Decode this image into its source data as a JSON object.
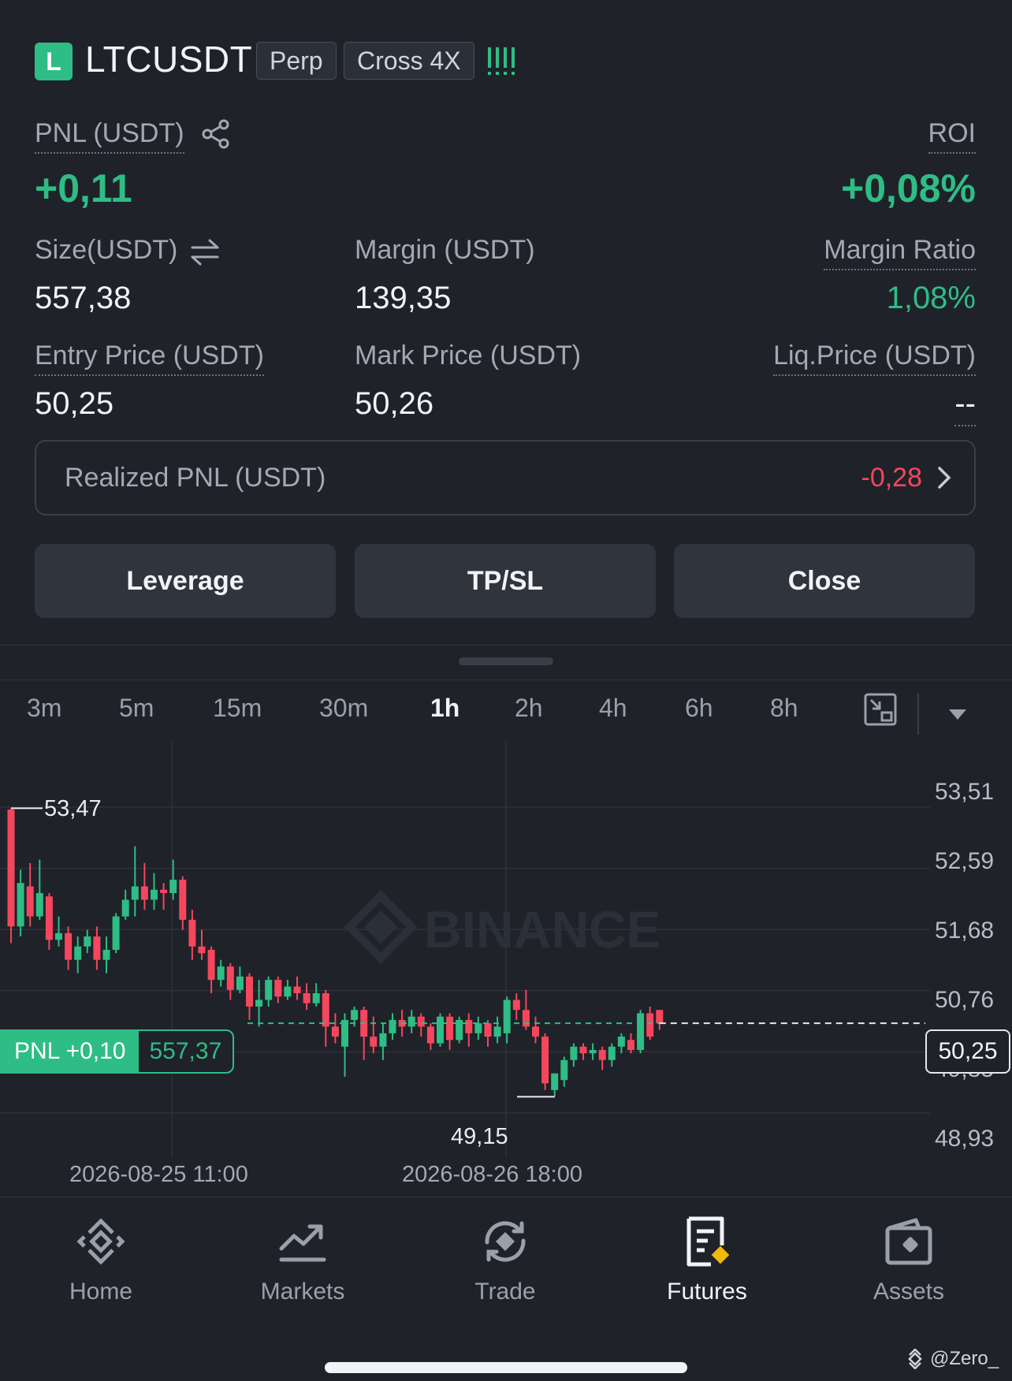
{
  "header": {
    "position_side": "L",
    "symbol": "LTCUSDT",
    "contract_type": "Perp",
    "margin_mode": "Cross 4X"
  },
  "position": {
    "pnl_label": "PNL (USDT)",
    "pnl_value": "+0,11",
    "roi_label": "ROI",
    "roi_value": "+0,08%",
    "size_label": "Size(USDT)",
    "size_value": "557,38",
    "margin_label": "Margin (USDT)",
    "margin_value": "139,35",
    "margin_ratio_label": "Margin Ratio",
    "margin_ratio_value": "1,08%",
    "entry_label": "Entry Price (USDT)",
    "entry_value": "50,25",
    "mark_label": "Mark Price (USDT)",
    "mark_value": "50,26",
    "liq_label": "Liq.Price (USDT)",
    "liq_value": "--",
    "realized_label": "Realized PNL (USDT)",
    "realized_value": "-0,28"
  },
  "actions": {
    "leverage": "Leverage",
    "tpsl": "TP/SL",
    "close": "Close"
  },
  "timeframes": [
    "3m",
    "5m",
    "15m",
    "30m",
    "1h",
    "2h",
    "4h",
    "6h",
    "8h"
  ],
  "active_timeframe": "1h",
  "chart_data": {
    "type": "candlestick",
    "watermark": "BINANCE",
    "y_ticks": [
      "53,51",
      "52,59",
      "51,68",
      "50,76",
      "49,85",
      "48,93"
    ],
    "x_ticks": [
      "2026-08-25 11:00",
      "2026-08-26 18:00"
    ],
    "ylim": [
      48.93,
      53.51
    ],
    "high_label": "53,47",
    "low_label": "49,15",
    "entry_price_label": "50,25",
    "pnl_tag": "PNL +0,10",
    "pnl_tag_size": "557,37",
    "candles": [
      [
        53.45,
        51.7,
        53.47,
        51.45
      ],
      [
        51.7,
        52.35,
        52.55,
        51.55
      ],
      [
        52.3,
        51.85,
        52.65,
        51.7
      ],
      [
        51.85,
        52.2,
        52.7,
        51.8
      ],
      [
        52.15,
        51.5,
        52.2,
        51.35
      ],
      [
        51.5,
        51.6,
        51.85,
        51.4
      ],
      [
        51.6,
        51.2,
        51.7,
        51.05
      ],
      [
        51.2,
        51.4,
        51.55,
        51.0
      ],
      [
        51.4,
        51.55,
        51.65,
        51.3
      ],
      [
        51.55,
        51.2,
        51.7,
        51.05
      ],
      [
        51.2,
        51.35,
        51.55,
        51.0
      ],
      [
        51.35,
        51.85,
        51.9,
        51.3
      ],
      [
        51.85,
        52.1,
        52.25,
        51.8
      ],
      [
        52.1,
        52.3,
        52.9,
        51.85
      ],
      [
        52.3,
        52.1,
        52.65,
        51.95
      ],
      [
        52.1,
        52.25,
        52.5,
        51.95
      ],
      [
        52.25,
        52.2,
        52.35,
        51.95
      ],
      [
        52.2,
        52.4,
        52.7,
        52.1
      ],
      [
        52.4,
        51.8,
        52.45,
        51.65
      ],
      [
        51.8,
        51.4,
        51.95,
        51.2
      ],
      [
        51.4,
        51.3,
        51.65,
        51.2
      ],
      [
        51.35,
        50.9,
        51.4,
        50.7
      ],
      [
        50.9,
        51.1,
        51.2,
        50.8
      ],
      [
        51.1,
        50.75,
        51.15,
        50.6
      ],
      [
        50.75,
        50.95,
        51.1,
        50.7
      ],
      [
        50.95,
        50.5,
        51.0,
        50.3
      ],
      [
        50.5,
        50.6,
        50.9,
        50.2
      ],
      [
        50.6,
        50.9,
        50.95,
        50.5
      ],
      [
        50.9,
        50.65,
        50.95,
        50.55
      ],
      [
        50.65,
        50.8,
        50.9,
        50.6
      ],
      [
        50.8,
        50.7,
        50.95,
        50.6
      ],
      [
        50.7,
        50.55,
        50.85,
        50.45
      ],
      [
        50.55,
        50.7,
        50.85,
        50.5
      ],
      [
        50.7,
        50.2,
        50.75,
        49.9
      ],
      [
        50.2,
        50.05,
        50.4,
        49.95
      ],
      [
        49.9,
        50.3,
        50.4,
        49.45
      ],
      [
        50.3,
        50.45,
        50.5,
        50.2
      ],
      [
        50.45,
        50.05,
        50.5,
        49.7
      ],
      [
        50.05,
        49.9,
        50.35,
        49.8
      ],
      [
        49.9,
        50.1,
        50.25,
        49.7
      ],
      [
        50.1,
        50.3,
        50.4,
        50.0
      ],
      [
        50.3,
        50.2,
        50.45,
        50.05
      ],
      [
        50.2,
        50.35,
        50.45,
        50.1
      ],
      [
        50.35,
        50.2,
        50.4,
        50.05
      ],
      [
        50.2,
        49.95,
        50.25,
        49.85
      ],
      [
        49.95,
        50.35,
        50.4,
        49.9
      ],
      [
        50.35,
        50.0,
        50.4,
        49.85
      ],
      [
        50.0,
        50.3,
        50.35,
        49.95
      ],
      [
        50.3,
        50.1,
        50.4,
        49.9
      ],
      [
        50.1,
        50.25,
        50.35,
        50.0
      ],
      [
        50.25,
        50.05,
        50.3,
        49.9
      ],
      [
        50.05,
        50.2,
        50.35,
        49.95
      ],
      [
        50.1,
        50.6,
        50.65,
        49.95
      ],
      [
        50.6,
        50.45,
        50.7,
        50.3
      ],
      [
        50.45,
        50.2,
        50.75,
        50.15
      ],
      [
        50.2,
        50.05,
        50.35,
        49.95
      ],
      [
        50.05,
        49.35,
        50.1,
        49.25
      ],
      [
        49.25,
        49.5,
        49.5,
        49.15
      ],
      [
        49.4,
        49.7,
        49.75,
        49.3
      ],
      [
        49.7,
        49.9,
        49.95,
        49.6
      ],
      [
        49.9,
        49.8,
        49.95,
        49.7
      ],
      [
        49.8,
        49.85,
        49.95,
        49.7
      ],
      [
        49.85,
        49.7,
        49.9,
        49.55
      ],
      [
        49.7,
        49.9,
        49.95,
        49.6
      ],
      [
        49.9,
        50.05,
        50.1,
        49.8
      ],
      [
        50.0,
        49.85,
        50.1,
        49.8
      ],
      [
        49.85,
        50.4,
        50.45,
        49.8
      ],
      [
        50.4,
        50.05,
        50.5,
        50.0
      ],
      [
        50.45,
        50.25,
        50.45,
        50.15
      ]
    ]
  },
  "nav": {
    "home": "Home",
    "markets": "Markets",
    "trade": "Trade",
    "futures": "Futures",
    "assets": "Assets"
  },
  "footer": {
    "credit": "@Zero_"
  },
  "colors": {
    "bg": "#1f2229",
    "up": "#2ebd85",
    "down": "#f6465d",
    "accent": "#f0b90b"
  }
}
